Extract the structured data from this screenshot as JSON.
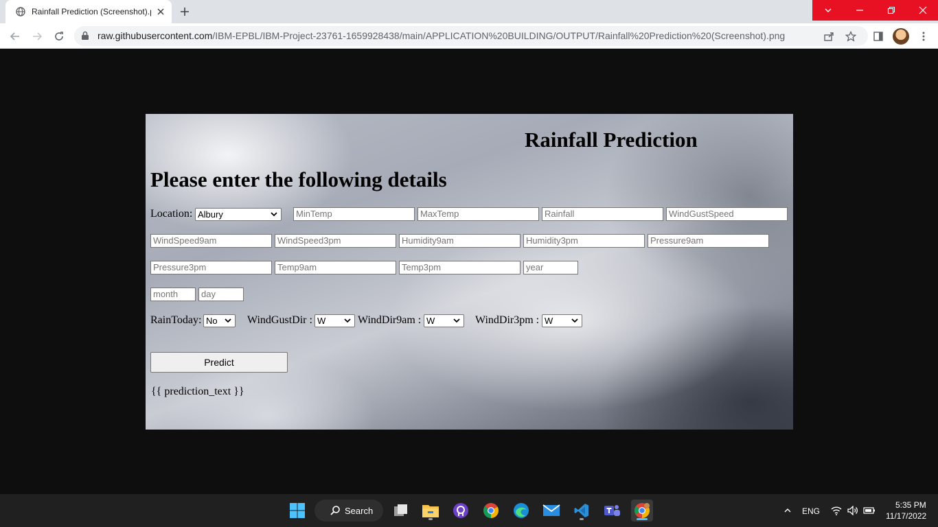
{
  "browser": {
    "tab_title": "Rainfall Prediction (Screenshot).p",
    "url_host": "raw.githubusercontent.com",
    "url_path": "/IBM-EPBL/IBM-Project-23761-1659928438/main/APPLICATION%20BUILDING/OUTPUT/Rainfall%20Prediction%20(Screenshot).png",
    "accent_color": "#e81123"
  },
  "app": {
    "title": "Rainfall Prediction",
    "subtitle": "Please enter the following details",
    "location_label": "Location:",
    "location_value": "Albury",
    "placeholders": {
      "min_temp": "MinTemp",
      "max_temp": "MaxTemp",
      "rainfall": "Rainfall",
      "wind_gust_speed": "WindGustSpeed",
      "wind_speed_9am": "WindSpeed9am",
      "wind_speed_3pm": "WindSpeed3pm",
      "humidity_9am": "Humidity9am",
      "humidity_3pm": "Humidity3pm",
      "pressure_9am": "Pressure9am",
      "pressure_3pm": "Pressure3pm",
      "temp_9am": "Temp9am",
      "temp_3pm": "Temp3pm",
      "year": "year",
      "month": "month",
      "day": "day"
    },
    "rain_today_label": "RainToday:",
    "rain_today_value": "No",
    "wind_gust_dir_label": "WindGustDir :",
    "wind_gust_dir_value": "W",
    "wind_dir_9am_label": "WindDir9am :",
    "wind_dir_9am_value": "W",
    "wind_dir_3pm_label": "WindDir3pm :",
    "wind_dir_3pm_value": "W",
    "predict_button": "Predict",
    "prediction_text": "{{ prediction_text }}"
  },
  "taskbar": {
    "search_label": "Search",
    "language": "ENG",
    "time": "5:35 PM",
    "date": "11/17/2022",
    "apps": [
      "start-icon",
      "task-view-icon",
      "file-explorer-icon",
      "github-desktop-icon",
      "chrome-icon",
      "edge-icon",
      "mail-icon",
      "vscode-icon",
      "teams-icon",
      "chrome-profile-icon"
    ]
  }
}
